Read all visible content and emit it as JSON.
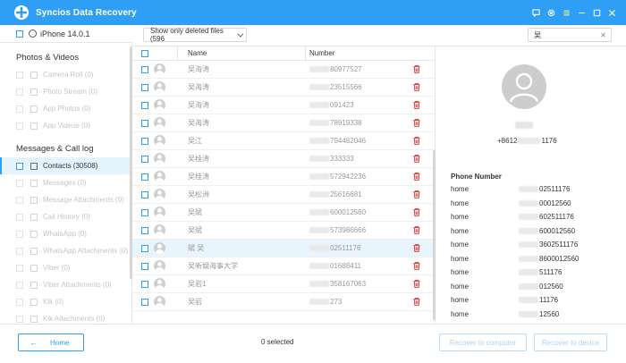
{
  "app": {
    "title": "Syncios Data Recovery"
  },
  "device": {
    "name": "iPhone 14.0.1"
  },
  "sidebar": {
    "sections": [
      {
        "title": "Photos & Videos",
        "items": [
          {
            "label": "Camera Roll (0)",
            "icon": "camera-icon"
          },
          {
            "label": "Photo Stream (0)",
            "icon": "photo-stream-icon"
          },
          {
            "label": "App Photos (0)",
            "icon": "image-icon"
          },
          {
            "label": "App Videos (0)",
            "icon": "video-icon"
          }
        ]
      },
      {
        "title": "Messages & Call log",
        "items": [
          {
            "label": "Contacts (30508)",
            "icon": "contacts-icon",
            "active": true
          },
          {
            "label": "Messages (0)",
            "icon": "message-icon"
          },
          {
            "label": "Message Attachments (0)",
            "icon": "attachment-icon"
          },
          {
            "label": "Call History (0)",
            "icon": "phone-icon"
          },
          {
            "label": "WhatsApp (0)",
            "icon": "whatsapp-icon"
          },
          {
            "label": "WhatsApp Attachments (0)",
            "icon": "whatsapp-icon"
          },
          {
            "label": "Viber (0)",
            "icon": "viber-icon"
          },
          {
            "label": "Viber Attachments (0)",
            "icon": "viber-icon"
          },
          {
            "label": "Kik (0)",
            "icon": "kik-icon"
          },
          {
            "label": "Kik Attachments (0)",
            "icon": "kik-icon"
          }
        ]
      }
    ]
  },
  "filter": {
    "selected": "Show only deleted files (596"
  },
  "search": {
    "value": "吴"
  },
  "table": {
    "headers": {
      "name": "Name",
      "number": "Number"
    },
    "rows": [
      {
        "name": "吴海涛",
        "number": "80977527"
      },
      {
        "name": "吴海涛",
        "number": "23515566"
      },
      {
        "name": "吴海涛",
        "number": "091423"
      },
      {
        "name": "吴海涛",
        "number": "78919338"
      },
      {
        "name": "吴江",
        "number": "794482046"
      },
      {
        "name": "吴桂涛",
        "number": "333333"
      },
      {
        "name": "吴桂涛",
        "number": "572942236"
      },
      {
        "name": "吴松洲",
        "number": "25616681"
      },
      {
        "name": "吴斌",
        "number": "600012560"
      },
      {
        "name": "吴斌",
        "number": "573986666"
      },
      {
        "name": "斌 吴",
        "number": "02511176",
        "selected": true
      },
      {
        "name": "吴新娱海事大学",
        "number": "01688411"
      },
      {
        "name": "吴岩1",
        "number": "358167063"
      },
      {
        "name": "吴岩",
        "number": "273"
      }
    ]
  },
  "detail": {
    "phone_prefix": "+8612",
    "phone_suffix": "1176",
    "phone_number_label": "Phone Number",
    "numbers": [
      {
        "type": "home",
        "value": "02511176"
      },
      {
        "type": "home",
        "value": "00012560"
      },
      {
        "type": "home",
        "value": "602511176"
      },
      {
        "type": "home",
        "value": "600012560"
      },
      {
        "type": "home",
        "value": "3602511176"
      },
      {
        "type": "home",
        "value": "8600012560"
      },
      {
        "type": "home",
        "value": "511176"
      },
      {
        "type": "home",
        "value": "012560"
      },
      {
        "type": "home",
        "value": "11176"
      },
      {
        "type": "home",
        "value": "12560"
      }
    ]
  },
  "footer": {
    "home_label": "Home",
    "selected_count": "0 selected",
    "recover_computer": "Recover to computer",
    "recover_device": "Recover to device"
  },
  "colors": {
    "accent": "#2f9ff5",
    "delete": "#e23c3c"
  }
}
